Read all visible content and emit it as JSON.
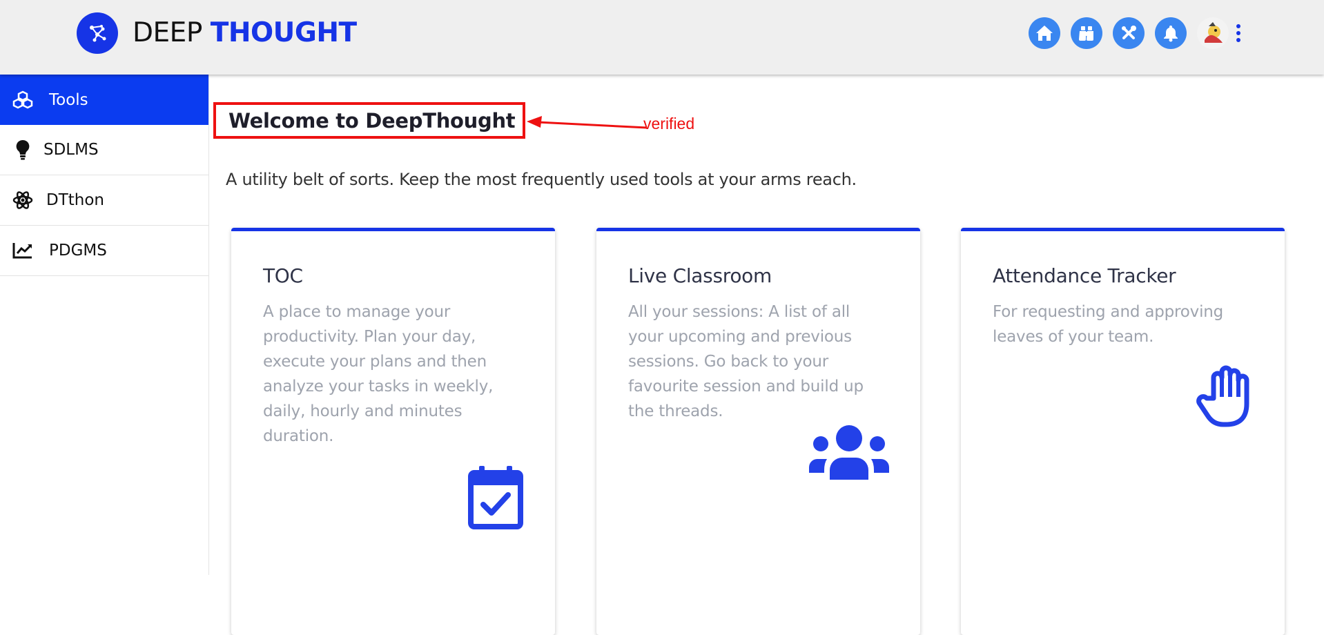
{
  "header": {
    "brand_part1": "DEEP",
    "brand_part2": "THOUGHT",
    "icons": [
      "home-icon",
      "binoculars-icon",
      "tools-icon",
      "bell-icon",
      "avatar",
      "more-vert-icon"
    ],
    "accent": "#1634e6",
    "icon_bg": "#3a86f0"
  },
  "sidebar": {
    "items": [
      {
        "label": "Tools",
        "icon": "cubes-icon",
        "active": true
      },
      {
        "label": "SDLMS",
        "icon": "lightbulb-icon",
        "active": false
      },
      {
        "label": "DTthon",
        "icon": "atom-icon",
        "active": false
      },
      {
        "label": "PDGMS",
        "icon": "chart-line-icon",
        "active": false
      }
    ]
  },
  "main": {
    "title": "Welcome to DeepThought",
    "annotation": "verified",
    "subtitle": "A utility belt of sorts. Keep the most frequently used tools at your arms reach.",
    "cards": [
      {
        "title": "TOC",
        "description": "A place to manage your productivity. Plan your day, execute your plans and then analyze your tasks in weekly, daily, hourly and minutes duration.",
        "icon": "calendar-check-icon"
      },
      {
        "title": "Live Classroom",
        "description": "All your sessions: A list of all your upcoming and previous sessions. Go back to your favourite session and build up the threads.",
        "icon": "users-icon"
      },
      {
        "title": "Attendance Tracker",
        "description": "For requesting and approving leaves of your team.",
        "icon": "hand-icon"
      }
    ]
  }
}
